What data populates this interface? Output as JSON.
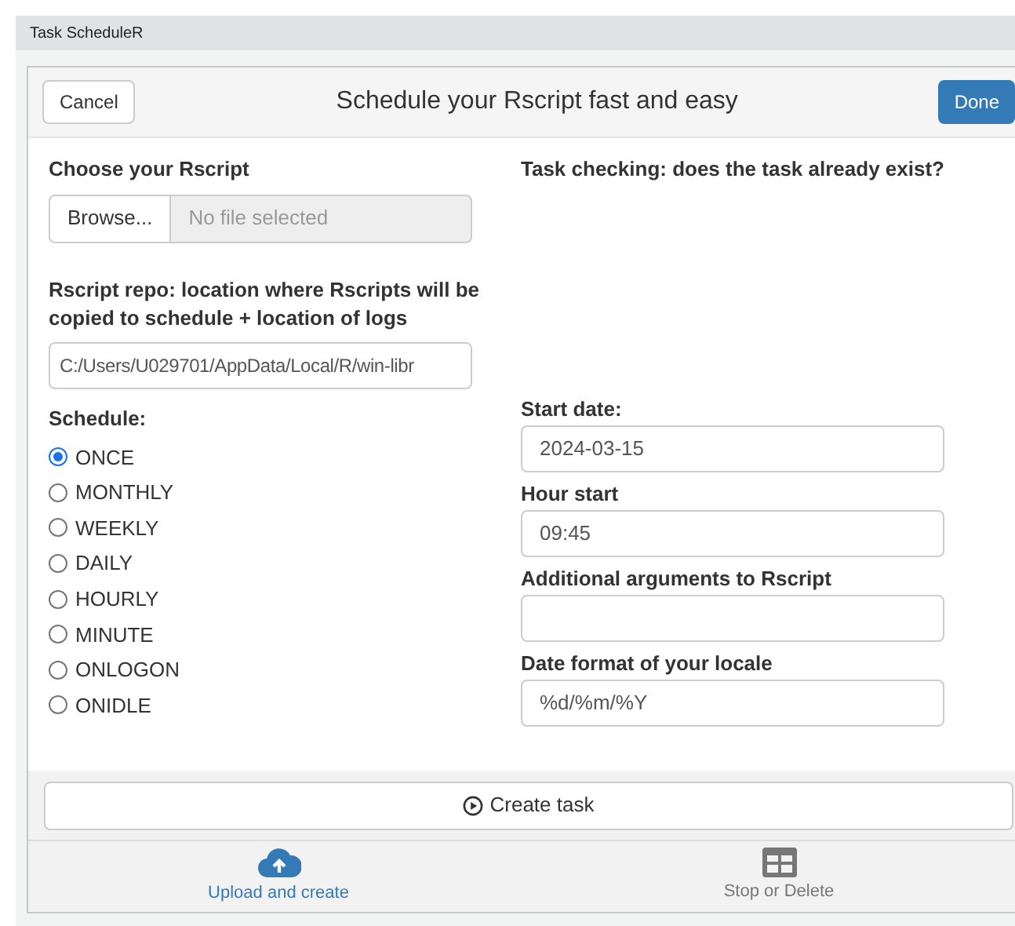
{
  "window": {
    "title": "Task ScheduleR"
  },
  "header": {
    "cancel": "Cancel",
    "title": "Schedule your Rscript fast and easy",
    "done": "Done"
  },
  "script_field": {
    "label": "Choose your Rscript",
    "browse": "Browse...",
    "placeholder": "No file selected"
  },
  "task_check": {
    "label": "Task checking: does the task already exist?"
  },
  "repo_field": {
    "label": "Rscript repo: location where Rscripts will be copied to schedule + location of logs",
    "value": "C:/Users/U029701/AppData/Local/R/win-libr"
  },
  "schedule": {
    "label": "Schedule:",
    "options": [
      {
        "label": "ONCE",
        "selected": true
      },
      {
        "label": "MONTHLY",
        "selected": false
      },
      {
        "label": "WEEKLY",
        "selected": false
      },
      {
        "label": "DAILY",
        "selected": false
      },
      {
        "label": "HOURLY",
        "selected": false
      },
      {
        "label": "MINUTE",
        "selected": false
      },
      {
        "label": "ONLOGON",
        "selected": false
      },
      {
        "label": "ONIDLE",
        "selected": false
      }
    ]
  },
  "fields": [
    {
      "label": "Start date:",
      "value": "2024-03-15"
    },
    {
      "label": "Hour start",
      "value": "09:45"
    },
    {
      "label": "Additional arguments to Rscript"
    },
    {
      "label": "Date format of your locale",
      "value": "%d/%m/%Y"
    }
  ],
  "create_button": "Create task",
  "bottom_tabs": [
    {
      "label": "Upload and create",
      "kind": "upload",
      "selected": true
    },
    {
      "label": "Stop or Delete",
      "kind": "table",
      "selected": false
    }
  ]
}
